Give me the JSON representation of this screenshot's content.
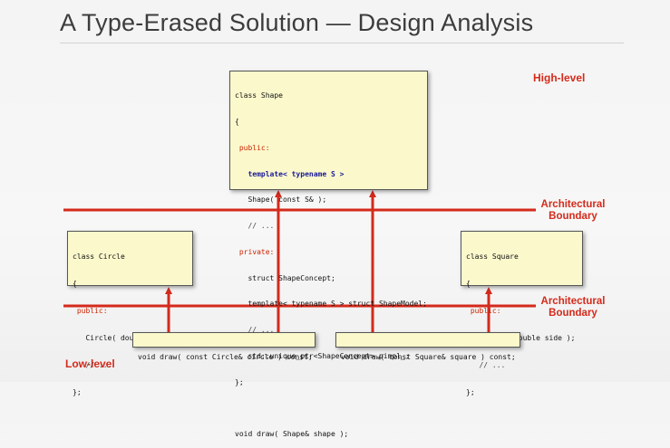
{
  "slide": {
    "title": "A Type-Erased Solution — Design Analysis",
    "high_level_label": "High-level",
    "low_level_label": "Low-level",
    "boundary_top": [
      "Architectural",
      "Boundary"
    ],
    "boundary_bottom": [
      "Architectural",
      "Boundary"
    ]
  },
  "shape_box": {
    "lines": [
      [
        "class Shape"
      ],
      [
        "{"
      ],
      [
        " public:"
      ],
      [
        "   template< typename S >"
      ],
      [
        "   Shape( const S& );"
      ],
      [
        "   // ..."
      ],
      [
        " private:"
      ],
      [
        "   struct ShapeConcept;"
      ],
      [
        "   template< typename S > struct ShapeModel;"
      ],
      [
        "   // ..."
      ],
      [
        "   std::unique_ptr<ShapeConcept> pimpl_;"
      ],
      [
        "};"
      ],
      [
        ""
      ],
      [
        "void draw( Shape& shape );"
      ]
    ]
  },
  "circle_box": {
    "lines": [
      "class Circle",
      "{",
      " public:",
      "   Circle( double radius );",
      "   // ...",
      "};"
    ]
  },
  "square_box": {
    "lines": [
      "class Square",
      "{",
      " public:",
      "   Square( double side );",
      "   // ...",
      "};"
    ]
  },
  "draw_circle": "void draw( const Circle& circle ) const;",
  "draw_square": "void draw( const Square& square ) const;",
  "colors": {
    "accent_red": "#d42a1b",
    "box_fill": "#fbf9cc"
  }
}
